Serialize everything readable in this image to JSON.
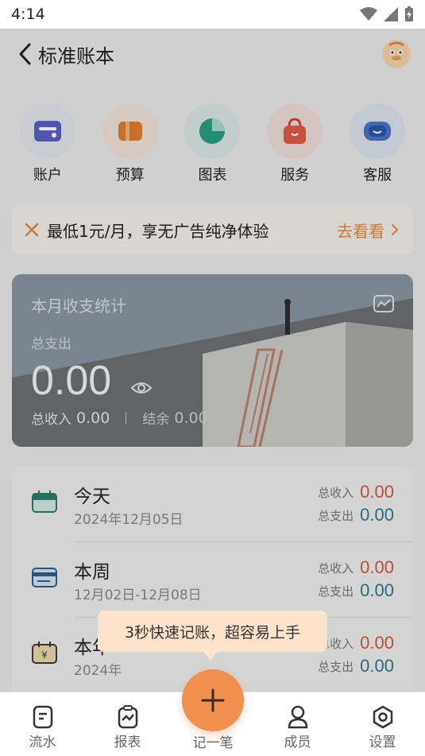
{
  "status_bar": {
    "time": "4:14"
  },
  "header": {
    "title": "标准账本"
  },
  "quick_actions": [
    {
      "label": "账户",
      "icon": "card-icon"
    },
    {
      "label": "预算",
      "icon": "budget-icon"
    },
    {
      "label": "图表",
      "icon": "pie-chart-icon"
    },
    {
      "label": "服务",
      "icon": "bag-icon"
    },
    {
      "label": "客服",
      "icon": "chat-bot-icon"
    }
  ],
  "promo": {
    "text": "最低1元/月，享无广告纯净体验",
    "link": "去看看"
  },
  "stats": {
    "title": "本月收支统计",
    "expense_label": "总支出",
    "expense_value": "0.00",
    "income_label": "总收入",
    "income_value": "0.00",
    "balance_label": "结余",
    "balance_value": "0.00"
  },
  "periods": [
    {
      "title": "今天",
      "date": "2024年12月05日",
      "income_label": "总收入",
      "income": "0.00",
      "expense_label": "总支出",
      "expense": "0.00"
    },
    {
      "title": "本周",
      "date": "12月02日-12月08日",
      "income_label": "总收入",
      "income": "0.00",
      "expense_label": "总支出",
      "expense": "0.00"
    },
    {
      "title": "本年",
      "date": "2024年",
      "income_label": "总收入",
      "income": "0.00",
      "expense_label": "总支出",
      "expense": "0.00"
    }
  ],
  "tooltip": {
    "text": "3秒快速记账，超容易上手"
  },
  "tabbar": {
    "items": [
      {
        "label": "流水"
      },
      {
        "label": "报表"
      },
      {
        "label": "记一笔"
      },
      {
        "label": "成员"
      },
      {
        "label": "设置"
      }
    ]
  },
  "colors": {
    "accent": "#f0904f",
    "income": "#d05a3a",
    "expense": "#2e7a8c"
  }
}
